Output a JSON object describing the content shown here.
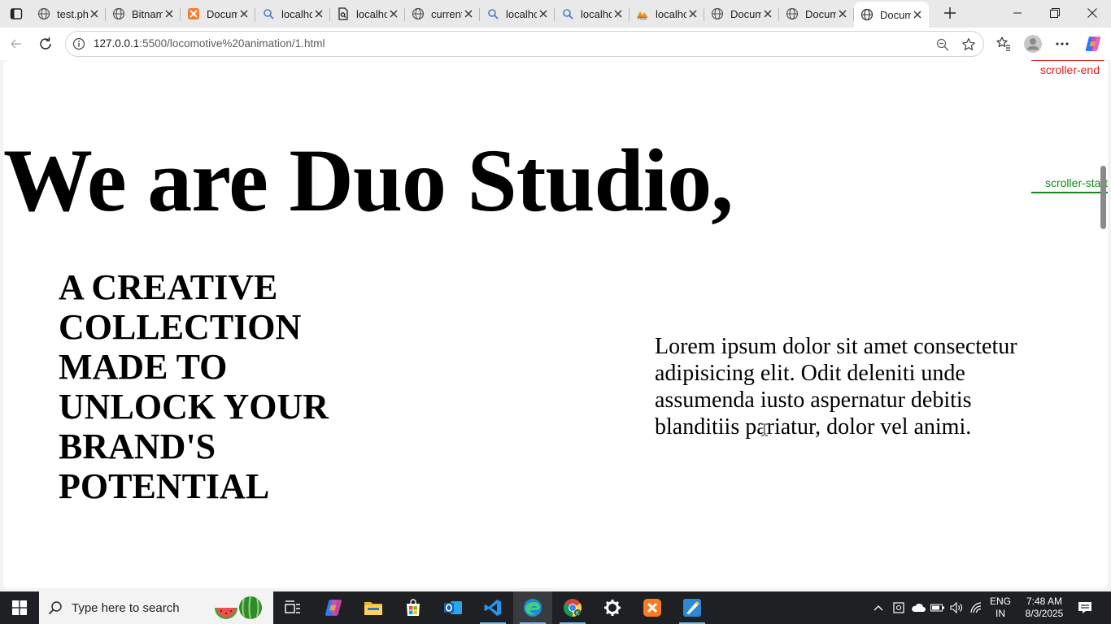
{
  "browser": {
    "tabs": [
      {
        "title": "test.php",
        "favicon": "globe-icon"
      },
      {
        "title": "Bitnami",
        "favicon": "globe-icon"
      },
      {
        "title": "Document",
        "favicon": "xampp-icon"
      },
      {
        "title": "localhost",
        "favicon": "search-icon"
      },
      {
        "title": "localhost",
        "favicon": "document-search-icon"
      },
      {
        "title": "current",
        "favicon": "globe-icon"
      },
      {
        "title": "localhost",
        "favicon": "search-icon"
      },
      {
        "title": "localhost",
        "favicon": "search-icon"
      },
      {
        "title": "localhost",
        "favicon": "phpmyadmin-icon"
      },
      {
        "title": "Document",
        "favicon": "globe-icon"
      },
      {
        "title": "Document",
        "favicon": "globe-icon"
      },
      {
        "title": "Document",
        "favicon": "globe-icon",
        "active": true
      }
    ],
    "address": {
      "host": "127.0.0.1",
      "rest": ":5500/locomotive%20animation/1.html"
    }
  },
  "page": {
    "hero": "We are Duo Studio,",
    "tagline": "A CREATIVE COLLECTION MADE TO UNLOCK YOUR BRAND'S POTENTIAL",
    "blurb": "Lorem ipsum dolor sit amet consectetur adipisicing elit. Odit deleniti unde assumenda iusto aspernatur debitis blanditiis pariatur, dolor vel animi.",
    "marker_end": "scroller-end",
    "marker_start": "scroller-start",
    "colors": {
      "marker_end": "#e0201c",
      "marker_start": "#138a17"
    }
  },
  "taskbar": {
    "search_placeholder": "Type here to search",
    "lang_line1": "ENG",
    "lang_line2": "IN",
    "time": "7:48 AM",
    "date": "8/3/2025",
    "apps": [
      "task-view-icon",
      "copilot-icon",
      "file-explorer-icon",
      "store-icon",
      "outlook-icon",
      "vscode-icon",
      "edge-icon",
      "chrome-icon",
      "settings-icon",
      "xampp-icon",
      "paint-icon"
    ]
  }
}
